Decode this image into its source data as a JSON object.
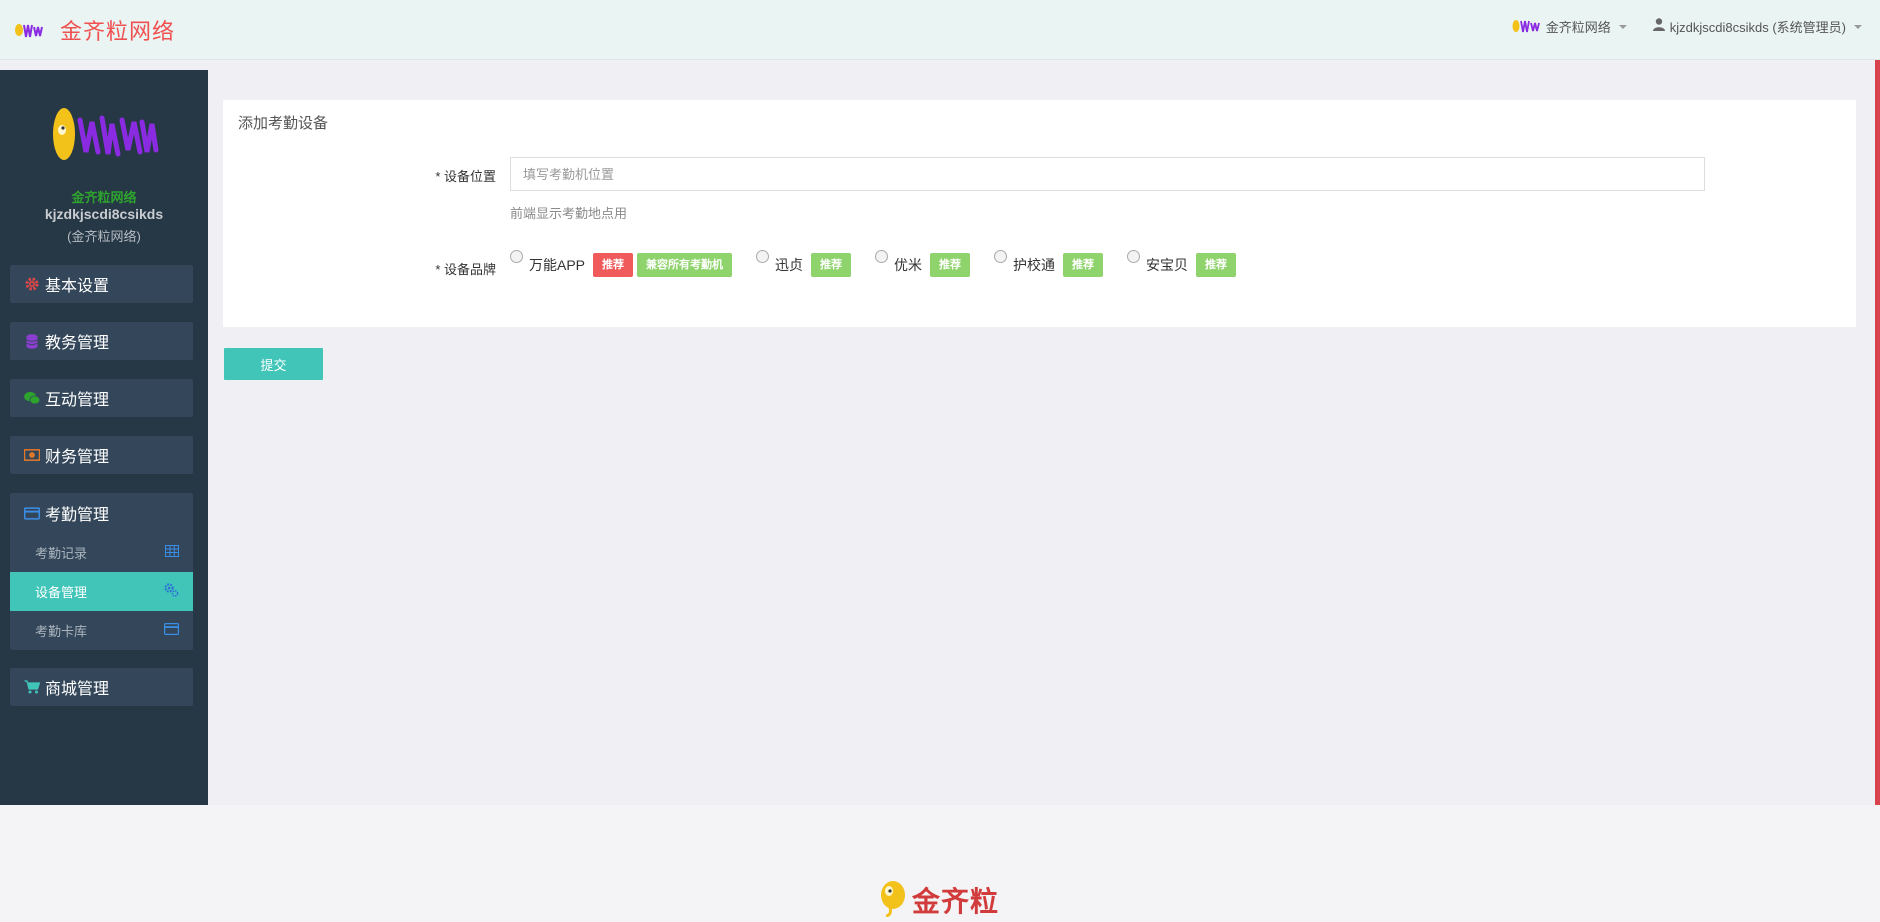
{
  "header": {
    "brand_name": "金齐粒网络",
    "org_switch_label": "金齐粒网络",
    "user_label": "kjzdkjscdi8csikds (系统管理员)"
  },
  "sidebar": {
    "org_name": "金齐粒网络",
    "username": "kjzdkjscdi8csikds",
    "role": "(金齐粒网络)",
    "menu": {
      "basic": "基本设置",
      "academic": "教务管理",
      "interactive": "互动管理",
      "finance": "财务管理",
      "attendance": "考勤管理",
      "attendance_sub": {
        "records": "考勤记录",
        "devices": "设备管理",
        "cards": "考勤卡库"
      },
      "mall": "商城管理"
    }
  },
  "form": {
    "title": "添加考勤设备",
    "location_label": "* 设备位置",
    "location_placeholder": "填写考勤机位置",
    "location_value": "",
    "location_help": "前端显示考勤地点用",
    "brand_label": "* 设备品牌",
    "brands": [
      {
        "name": "万能APP",
        "badges": [
          "推荐",
          "兼容所有考勤机"
        ]
      },
      {
        "name": "迅贞",
        "badges": [
          "推荐"
        ]
      },
      {
        "name": "优米",
        "badges": [
          "推荐"
        ]
      },
      {
        "name": "护校通",
        "badges": [
          "推荐"
        ]
      },
      {
        "name": "安宝贝",
        "badges": [
          "推荐"
        ]
      }
    ],
    "submit_label": "提交"
  },
  "footer": {
    "logo_text": "金齐粒"
  },
  "colors": {
    "accent": "#41c5b9",
    "brand_red": "#f05050",
    "sidebar_bg": "#263746",
    "badge_red": "#f05a5a",
    "badge_green": "#8fd36c"
  }
}
